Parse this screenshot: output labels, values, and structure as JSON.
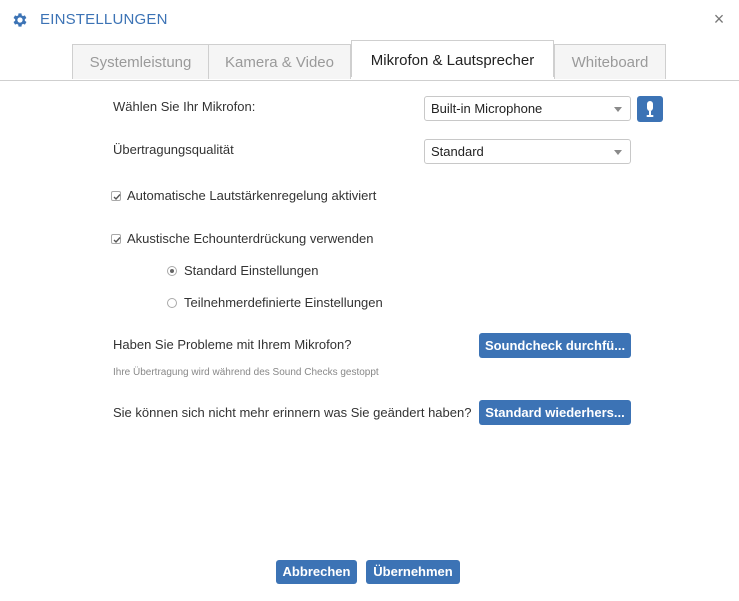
{
  "header": {
    "title": "EINSTELLUNGEN",
    "close_glyph": "×",
    "accent_color": "#3c73b5"
  },
  "tabs": [
    {
      "label": "Systemleistung",
      "active": false
    },
    {
      "label": "Kamera & Video",
      "active": false
    },
    {
      "label": "Mikrofon & Lautsprecher",
      "active": true
    },
    {
      "label": "Whiteboard",
      "active": false
    }
  ],
  "microphone": {
    "label": "Wählen Sie Ihr Mikrofon:",
    "selected": "Built-in Microphone"
  },
  "quality": {
    "label": "Übertragungsqualität",
    "selected": "Standard"
  },
  "agc": {
    "label": "Automatische Lautstärkenregelung aktiviert",
    "checked": true
  },
  "echo": {
    "label": "Akustische Echounterdrückung verwenden",
    "checked": true,
    "options": [
      {
        "label": "Standard Einstellungen",
        "selected": true
      },
      {
        "label": "Teilnehmerdefinierte Einstellungen",
        "selected": false
      }
    ]
  },
  "soundcheck": {
    "question": "Haben Sie Probleme mit Ihrem Mikrofon?",
    "button": "Soundcheck durchfü...",
    "note": "Ihre Übertragung wird während des Sound Checks gestoppt"
  },
  "restore": {
    "question": "Sie können sich nicht mehr erinnern was Sie geändert haben?",
    "button": "Standard wiederhers..."
  },
  "footer": {
    "cancel": "Abbrechen",
    "apply": "Übernehmen"
  }
}
